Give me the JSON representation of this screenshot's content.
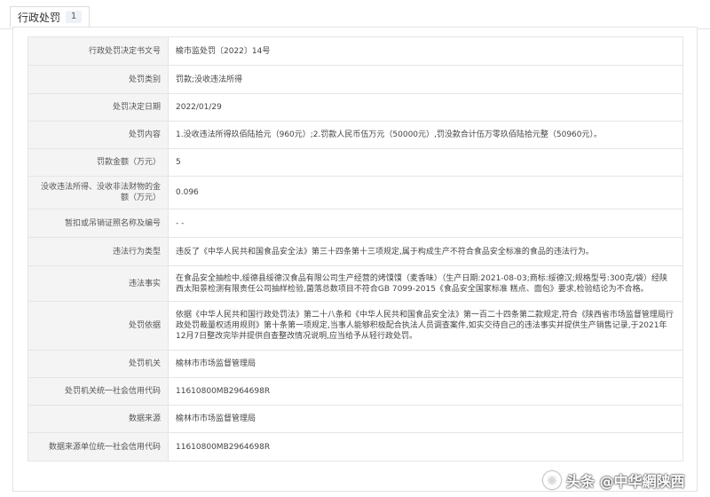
{
  "tab": {
    "label": "行政处罚",
    "count": "1"
  },
  "rows": [
    {
      "label": "行政处罚决定书文号",
      "value": "榆市监处罚〔2022〕14号"
    },
    {
      "label": "处罚类别",
      "value": "罚款;没收违法所得"
    },
    {
      "label": "处罚决定日期",
      "value": "2022/01/29"
    },
    {
      "label": "处罚内容",
      "value": "1.没收违法所得玖佰陆拾元（960元）;2.罚款人民币伍万元（50000元）,罚没款合计伍万零玖佰陆拾元整（50960元）。"
    },
    {
      "label": "罚款金额（万元）",
      "value": "5"
    },
    {
      "label": "没收违法所得、没收非法财物的金额（万元）",
      "value": "0.096"
    },
    {
      "label": "暂扣或吊销证照名称及编号",
      "value": "- -"
    },
    {
      "label": "违法行为类型",
      "value": "违反了《中华人民共和国食品安全法》第三十四条第十三项规定,属于构成生产不符合食品安全标准的食品的违法行为。"
    },
    {
      "label": "违法事实",
      "value": "在食品安全抽检中,绥德县绥德汉食品有限公司生产经营的烤馍馍（麦香味）（生产日期:2021-08-03;商标:绥德汉;规格型号:300克/袋）经陕西太阳景检测有限责任公司抽样检验,菌落总数项目不符合GB 7099-2015《食品安全国家标准 糕点、面包》要求,检验结论为不合格。"
    },
    {
      "label": "处罚依据",
      "value": "依据《中华人民共和国行政处罚法》第二十八条和《中华人民共和国食品安全法》第一百二十四条第二款规定,符合《陕西省市场监督管理局行政处罚裁量权适用规则》第十条第一项规定,当事人能够积极配合执法人员调查案件,如实交待自己的违法事实并提供生产销售记录,于2021年12月7日整改完毕并提供自查整改情况说明,应当给予从轻行政处罚。"
    },
    {
      "label": "处罚机关",
      "value": "榆林市市场监督管理局"
    },
    {
      "label": "处罚机关统一社会信用代码",
      "value": "11610800MB2964698R"
    },
    {
      "label": "数据来源",
      "value": "榆林市市场监督管理局"
    },
    {
      "label": "数据来源单位统一社会信用代码",
      "value": "11610800MB2964698R"
    }
  ],
  "watermark": {
    "text": "头条 @中华網陕西",
    "icon": "badge-logo-icon"
  }
}
